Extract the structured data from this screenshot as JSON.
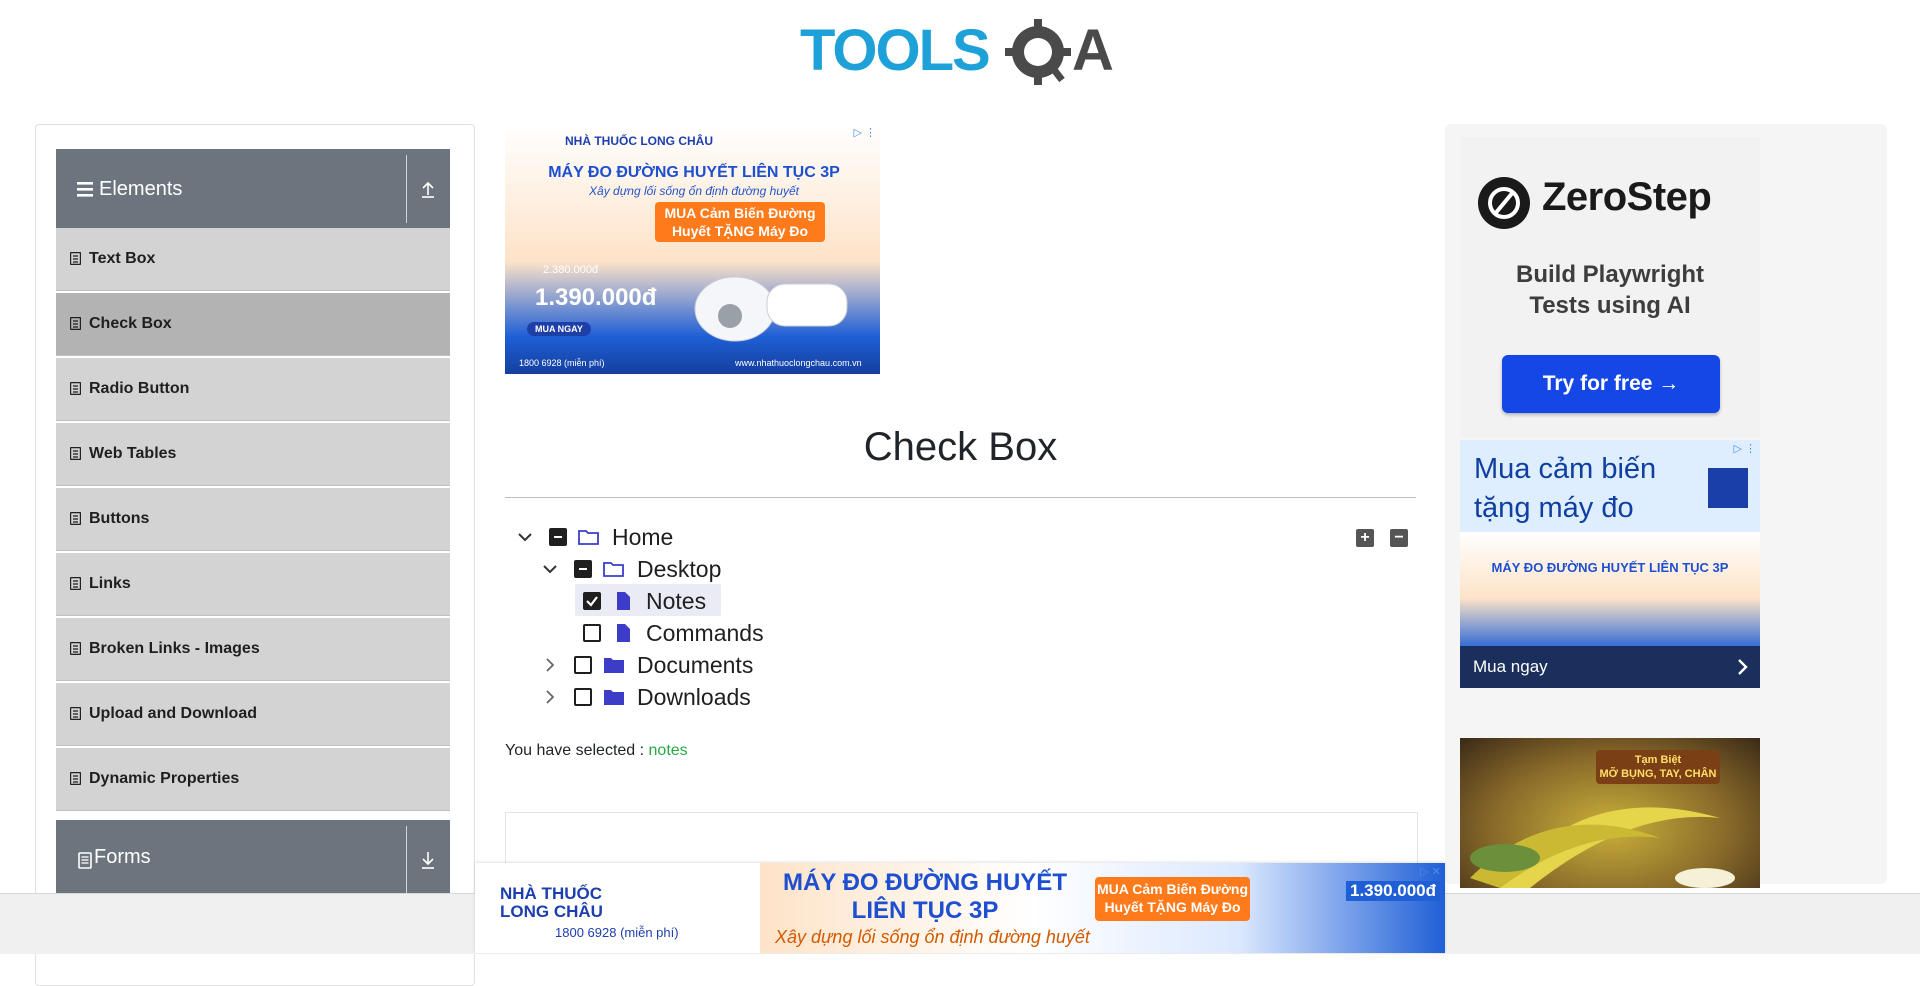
{
  "header": {
    "logo_text": "TOOLSQA"
  },
  "sidebar": {
    "elements_group": {
      "label": "Elements"
    },
    "items": [
      {
        "label": "Text Box"
      },
      {
        "label": "Check Box"
      },
      {
        "label": "Radio Button"
      },
      {
        "label": "Web Tables"
      },
      {
        "label": "Buttons"
      },
      {
        "label": "Links"
      },
      {
        "label": "Broken Links - Images"
      },
      {
        "label": "Upload and Download"
      },
      {
        "label": "Dynamic Properties"
      }
    ],
    "active_item": "Check Box",
    "forms_group": {
      "label": "Forms"
    }
  },
  "main": {
    "title": "Check Box",
    "tree": {
      "home": "Home",
      "desktop": "Desktop",
      "notes": "Notes",
      "commands": "Commands",
      "documents": "Documents",
      "downloads": "Downloads"
    },
    "result": {
      "prefix": "You have selected :",
      "value": "notes"
    }
  },
  "ads": {
    "top": {
      "brand": "NHÀ THUỐC LONG CHÂU",
      "headline": "MÁY ĐO ĐƯỜNG HUYẾT LIÊN TỤC 3P",
      "sub": "Xây dựng lối sống ổn định đường huyết",
      "promo": "MUA Cảm Biến Đường Huyết TẶNG Máy Đo",
      "old_price": "2.380.000đ",
      "price": "1.390.000đ",
      "cta": "MUA NGAY",
      "phone": "1800 6928 (miễn phí)",
      "url": "www.nhathuoclongchau.com.vn"
    },
    "zerostep": {
      "name": "ZeroStep",
      "line1": "Build Playwright",
      "line2": "Tests using AI",
      "button": "Try for free →"
    },
    "right": {
      "title_line1": "Mua cảm biến",
      "title_line2": "tặng máy đo",
      "headline": "MÁY ĐO ĐƯỜNG HUYẾT LIÊN TỤC 3P",
      "cta": "Mua ngay"
    },
    "banana": {
      "line1": "Tạm Biệt",
      "line2": "MỠ BỤNG, TAY, CHÂN"
    },
    "sticky": {
      "brand_line1": "NHÀ THUỐC",
      "brand_line2": "LONG CHÂU",
      "phone": "1800 6928 (miễn phí)",
      "head_line1": "MÁY ĐO ĐƯỜNG HUYẾT",
      "head_line2": "LIÊN TỤC 3P",
      "sub": "Xây dựng lối sống ổn định đường huyết",
      "promo": "MUA Cảm Biến Đường Huyết TẶNG Máy Đo",
      "price": "1.390.000đ"
    }
  },
  "colors": {
    "sidebar_header": "#6c757d",
    "menu_item": "#d3d3d3",
    "menu_active": "#b3b3b3",
    "folder_icon": "#3c3cc8",
    "selected_text": "#28a745",
    "logo_blue": "#1ea1d8",
    "logo_dark": "#4a4a4a"
  }
}
